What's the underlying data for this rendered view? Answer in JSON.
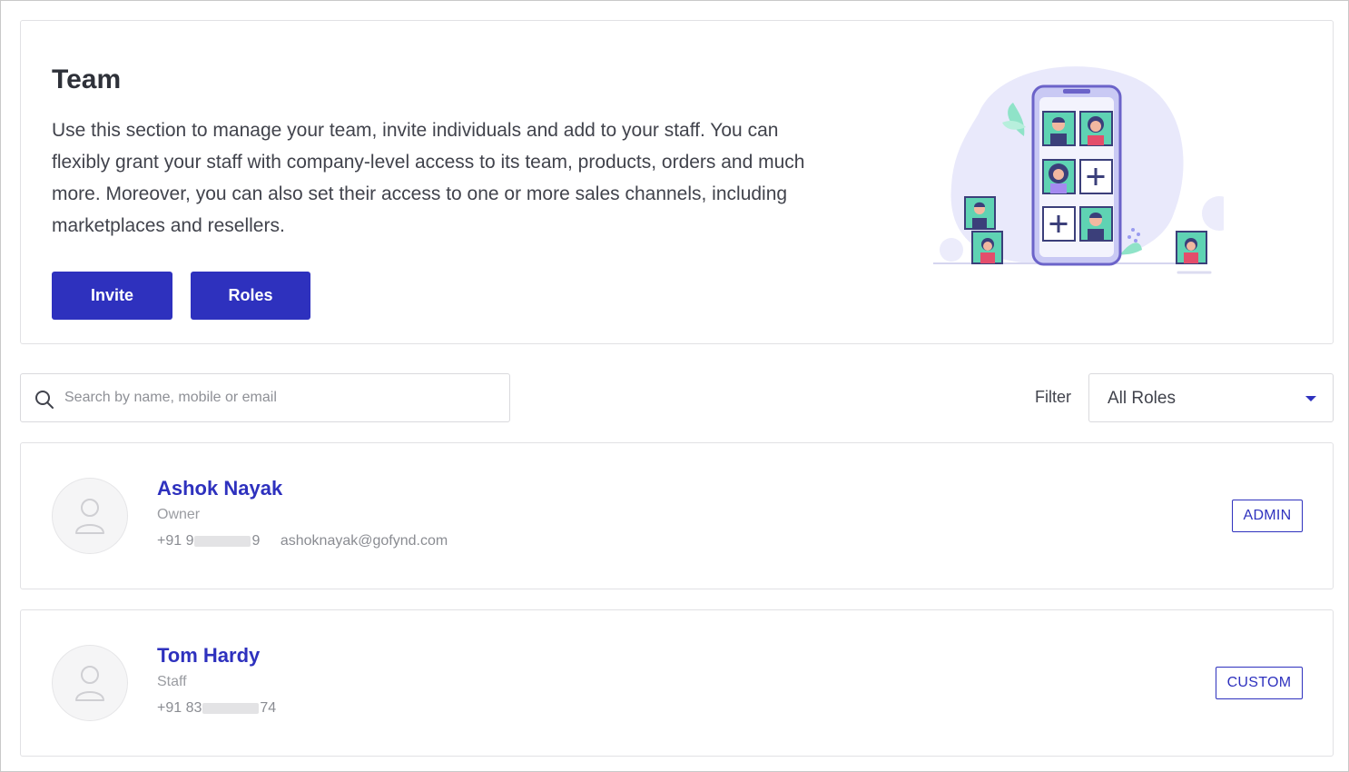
{
  "hero": {
    "title": "Team",
    "description": "Use this section to manage your team, invite individuals and add to your staff. You can flexibly grant your staff with company-level access to its team, products, orders and much more. Moreover, you can also set their access to one or more sales channels, including marketplaces and resellers.",
    "invite_label": "Invite",
    "roles_label": "Roles"
  },
  "search": {
    "placeholder": "Search by name, mobile or email",
    "value": ""
  },
  "filter": {
    "label": "Filter",
    "selected": "All Roles"
  },
  "members": [
    {
      "name": "Ashok Nayak",
      "role": "Owner",
      "phone_prefix": "+91 9",
      "phone_suffix": "9",
      "email": "ashoknayak@gofynd.com",
      "badge": "ADMIN"
    },
    {
      "name": "Tom Hardy",
      "role": "Staff",
      "phone_prefix": "+91 83",
      "phone_suffix": "74",
      "email": "",
      "badge": "CUSTOM"
    }
  ],
  "colors": {
    "primary": "#2e31be",
    "text": "#41434c",
    "muted": "#9a9ca1",
    "border": "#e1e1e4",
    "illustration_bg": "#e9e9fb",
    "illustration_teal": "#5fd3b3"
  },
  "icons": {
    "search": "search-icon",
    "caret": "chevron-down-icon",
    "avatar": "user-icon"
  }
}
